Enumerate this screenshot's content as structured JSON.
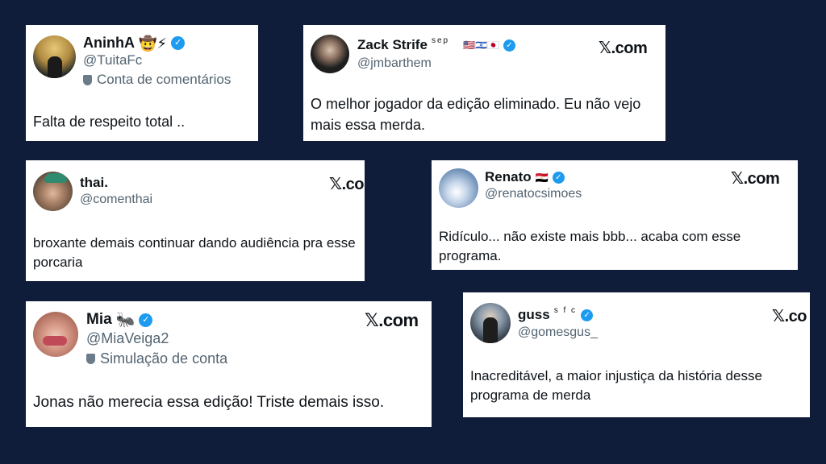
{
  "tweets": [
    {
      "name": "AninhA",
      "emojis": "🤠⚡",
      "handle": "@TuitaFc",
      "label": "Conta de comentários",
      "text": "Falta de respeito total ..",
      "avatar_color": "#2b2f2a"
    },
    {
      "name": "Zack Strife",
      "superscript": "sep",
      "emojis": "🇺🇸🇮🇱🇯🇵",
      "handle": "@jmbarthem",
      "text": "O melhor jogador da edição eliminado. Eu não vejo mais essa merda.",
      "x_logo": "𝕏.com",
      "avatar_color": "#2a2a2a"
    },
    {
      "name": "thai.",
      "handle": "@comenthai",
      "text": "broxante demais continuar dando audiência pra esse porcaria",
      "x_logo": "𝕏.co",
      "avatar_color": "#6b5a4a"
    },
    {
      "name": "Renato",
      "emojis": "🇪🇬",
      "handle": "@renatocsimoes",
      "text": "Ridículo... não existe mais bbb... acaba com esse programa.",
      "x_logo": "𝕏.com",
      "avatar_color": "#7fa0c0"
    },
    {
      "name": "Mia",
      "emojis": "🐜",
      "handle": "@MiaVeiga2",
      "label": "Simulação de conta",
      "text": "Jonas não merecia essa edição! Triste demais isso.",
      "x_logo": "𝕏.com",
      "avatar_color": "#c98a7a"
    },
    {
      "name": "guss",
      "superscript": "s f c",
      "handle": "@gomesgus_",
      "text": "Inacreditável, a maior injustiça da história desse programa de merda",
      "x_logo": "𝕏.co",
      "avatar_color": "#3a4550"
    }
  ],
  "colors": {
    "background": "#0f1d3a",
    "verified": "#1d9bf0",
    "handle": "#536471",
    "text": "#0f1419"
  }
}
